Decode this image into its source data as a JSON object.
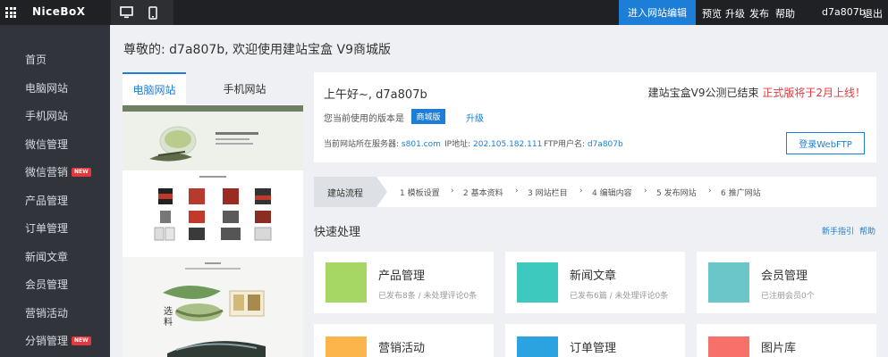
{
  "topbar": {
    "logo": "NiceBoX",
    "edit_label": "进入网站编辑",
    "links": [
      "预览",
      "升级",
      "发布",
      "帮助"
    ],
    "user": "d7a807b",
    "logout": "退出"
  },
  "sidebar": {
    "items": [
      {
        "label": "首页"
      },
      {
        "label": "电脑网站"
      },
      {
        "label": "手机网站"
      },
      {
        "label": "微信管理"
      },
      {
        "label": "微信营销",
        "badge": "NEW"
      },
      {
        "label": "产品管理"
      },
      {
        "label": "订单管理"
      },
      {
        "label": "新闻文章"
      },
      {
        "label": "会员管理"
      },
      {
        "label": "营销活动"
      },
      {
        "label": "分销管理",
        "badge": "NEW"
      }
    ]
  },
  "main": {
    "greeting": "尊敬的: d7a807b, 欢迎使用建站宝盒 V9商城版",
    "preview_tabs": [
      "电脑网站",
      "手机网站"
    ],
    "info": {
      "hello": "上午好~, d7a807b",
      "notice_prefix": "建站宝盒V9公测已结束",
      "notice_red": "正式版将于2月上线！",
      "version_label": "您当前使用的版本是",
      "version": "商城版",
      "upgrade": "升级",
      "server_label": "当前网站所在服务器:",
      "server": "s801.com",
      "ip_label": "IP地址:",
      "ip": "202.105.182.111",
      "ftp_label": "FTP用户名:",
      "ftp_user": "d7a807b",
      "ftp_button": "登录WebFTP"
    },
    "flow": {
      "title": "建站流程",
      "steps": [
        "1 模板设置",
        "2 基本资料",
        "3 网站栏目",
        "4 编辑内容",
        "5 发布网站",
        "6 推广网站"
      ]
    },
    "quick": {
      "title": "快速处理",
      "links": [
        "新手指引",
        "帮助"
      ],
      "tiles": [
        {
          "title": "产品管理",
          "sub": "已发布8条 / 未处理评论0条",
          "color": "#a6d764"
        },
        {
          "title": "新闻文章",
          "sub": "已发布6篇 / 未处理评论0条",
          "color": "#3ec9bf"
        },
        {
          "title": "会员管理",
          "sub": "已注册会员0个",
          "color": "#6ac6c8"
        },
        {
          "title": "营销活动",
          "sub": "",
          "color": "#fbb54a"
        },
        {
          "title": "订单管理",
          "sub": "",
          "color": "#2aa3e0"
        },
        {
          "title": "图片库",
          "sub": "",
          "color": "#f7706a"
        }
      ]
    }
  }
}
